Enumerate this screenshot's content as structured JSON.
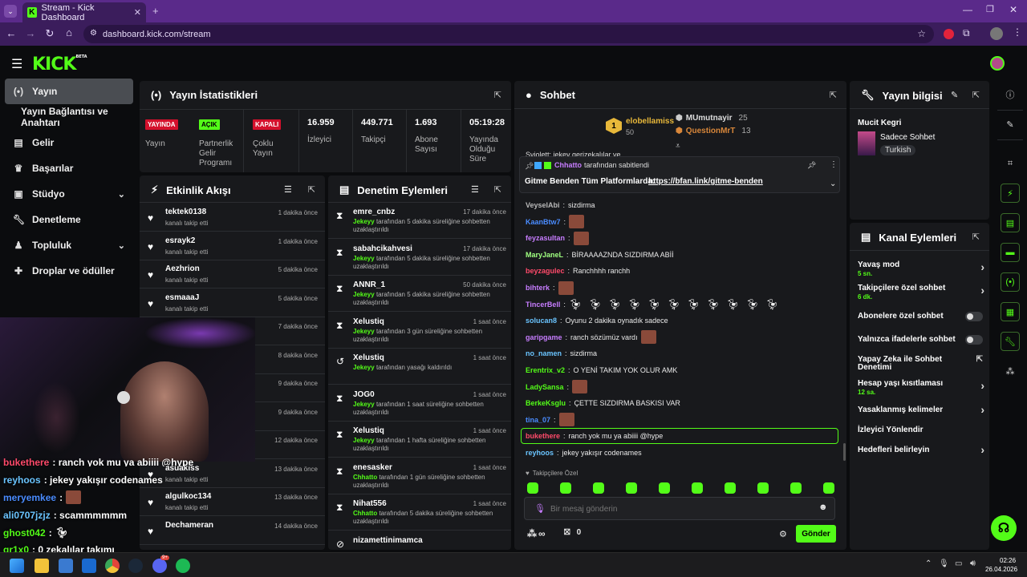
{
  "browser": {
    "tab_title": "Stream - Kick Dashboard",
    "url": "dashboard.kick.com/stream"
  },
  "app": {
    "logo": "KICK",
    "logo_sup": "BETA"
  },
  "sidebar": {
    "items": [
      {
        "label": "Yayın",
        "icon": "broadcast-icon"
      },
      {
        "label": "Yayın Bağlantısı ve Anahtarı",
        "icon": ""
      },
      {
        "label": "Gelir",
        "icon": "chart-icon"
      },
      {
        "label": "Başarılar",
        "icon": "trophy-icon"
      },
      {
        "label": "Stüdyo",
        "icon": "studio-icon"
      },
      {
        "label": "Denetleme",
        "icon": "wrench-icon"
      },
      {
        "label": "Topluluk",
        "icon": "community-icon"
      },
      {
        "label": "Droplar ve ödüller",
        "icon": "gift-icon"
      }
    ]
  },
  "stats": {
    "title": "Yayın İstatistikleri",
    "items": [
      {
        "badge": "YAYINDA",
        "label": "Yayın"
      },
      {
        "badge": "AÇIK",
        "label": "Partnerlik Gelir Programı"
      },
      {
        "badge": "KAPALI",
        "label": "Çoklu Yayın"
      },
      {
        "value": "16.959",
        "label": "İzleyici"
      },
      {
        "value": "449.771",
        "label": "Takipçi"
      },
      {
        "value": "1.693",
        "label": "Abone Sayısı"
      },
      {
        "value": "05:19:28",
        "label": "Yayında Olduğu Süre"
      }
    ]
  },
  "activity": {
    "title": "Etkinlik Akışı",
    "rows": [
      {
        "name": "tektek0138",
        "sub": "kanalı takip etti",
        "time": "1 dakika önce"
      },
      {
        "name": "esrayk2",
        "sub": "kanalı takip etti",
        "time": "1 dakika önce"
      },
      {
        "name": "Aezhrion",
        "sub": "kanalı takip etti",
        "time": "5 dakika önce"
      },
      {
        "name": "esmaaaJ",
        "sub": "kanalı takip etti",
        "time": "5 dakika önce"
      },
      {
        "name": "",
        "sub": "",
        "time": "7 dakika önce"
      },
      {
        "name": "",
        "sub": "",
        "time": "8 dakika önce"
      },
      {
        "name": "",
        "sub": "",
        "time": "9 dakika önce"
      },
      {
        "name": "",
        "sub": "",
        "time": "9 dakika önce"
      },
      {
        "name": "",
        "sub": "kanalı takip etti",
        "time": "12 dakika önce"
      },
      {
        "name": "asuakiss",
        "sub": "kanalı takip etti",
        "time": "13 dakika önce"
      },
      {
        "name": "algulkoc134",
        "sub": "kanalı takip etti",
        "time": "13 dakika önce"
      },
      {
        "name": "Dechameran",
        "sub": "",
        "time": "14 dakika önce"
      }
    ]
  },
  "moderation": {
    "title": "Denetim Eylemleri",
    "rows": [
      {
        "name": "emre_cnbz",
        "actor": "Jekeyy",
        "desc": "tarafından 5 dakika süreliğine sohbetten uzaklaştırıldı",
        "time": "17 dakika önce",
        "icon": "hourglass-icon"
      },
      {
        "name": "sabahcikahvesi",
        "actor": "Jekeyy",
        "desc": "tarafından 5 dakika süreliğine sohbetten uzaklaştırıldı",
        "time": "17 dakika önce",
        "icon": "hourglass-icon"
      },
      {
        "name": "ANNR_1",
        "actor": "Jekeyy",
        "desc": "tarafından 5 dakika süreliğine sohbetten uzaklaştırıldı",
        "time": "50 dakika önce",
        "icon": "hourglass-icon"
      },
      {
        "name": "Xelustiq",
        "actor": "Jekeyy",
        "desc": "tarafından 3 gün süreliğine sohbetten uzaklaştırıldı",
        "time": "1 saat önce",
        "icon": "hourglass-icon"
      },
      {
        "name": "Xelustiq",
        "actor": "Jekeyy",
        "desc": "tarafından yasağı kaldırıldı",
        "time": "1 saat önce",
        "icon": "undo-icon"
      },
      {
        "name": "JOG0",
        "actor": "Jekeyy",
        "desc": "tarafından 1 saat süreliğine sohbetten uzaklaştırıldı",
        "time": "1 saat önce",
        "icon": "hourglass-icon"
      },
      {
        "name": "Xelustiq",
        "actor": "Jekeyy",
        "desc": "tarafından 1 hafta süreliğine sohbetten uzaklaştırıldı",
        "time": "1 saat önce",
        "icon": "hourglass-icon"
      },
      {
        "name": "enesasker",
        "actor": "Chhatto",
        "desc": "tarafından 1 gün süreliğine sohbetten uzaklaştırıldı",
        "time": "1 saat önce",
        "icon": "hourglass-icon"
      },
      {
        "name": "Nihat556",
        "actor": "Chhatto",
        "desc": "tarafından 5 dakika süreliğine sohbetten uzaklaştırıldı",
        "time": "1 saat önce",
        "icon": "hourglass-icon"
      },
      {
        "name": "nizamettinimamca",
        "actor": "",
        "desc": "",
        "time": "",
        "icon": "ban-icon"
      }
    ]
  },
  "chat": {
    "title": "Sohbet",
    "top_gifters": [
      {
        "name": "elobellamiss",
        "value": "50"
      },
      {
        "name": "MUmutnayir",
        "value": "25"
      },
      {
        "name": "QuestionMrT",
        "value": "13"
      }
    ],
    "partial_line": "Sviolett: jekey gerizekalılar ve",
    "pinned": {
      "by": "Chhatto",
      "label": "tarafından sabitlendi",
      "text": "Gitme Benden Tüm Platformlarda:",
      "link": "https://bfan.link/gitme-benden"
    },
    "messages": [
      {
        "user": "VeyselAbi",
        "text": "sizdirma",
        "color": "#b8b8b8"
      },
      {
        "user": "KaanBtw7",
        "text": "",
        "color": "#4a8cff",
        "emote": true
      },
      {
        "user": "feyzasultan",
        "text": "",
        "color": "#c77dff",
        "emote": true
      },
      {
        "user": "MaryJaneL",
        "text": "BİRAAAAZNDA SIZDIRMA ABİİ",
        "color": "#a0ff80"
      },
      {
        "user": "beyzagulec",
        "text": "Ranchhhh ranchh",
        "color": "#ff4a6a"
      },
      {
        "user": "bihterk",
        "text": "",
        "color": "#c77dff",
        "emote": true
      },
      {
        "user": "TincerBell",
        "text": "",
        "color": "#c77dff",
        "ducks": true
      },
      {
        "user": "solucan8",
        "text": "Oyunu 2 dakika oynadık sadece",
        "color": "#6ac4ff"
      },
      {
        "user": "garipgame",
        "text": "ranch sözümüz vardı",
        "color": "#c77dff",
        "emote": true
      },
      {
        "user": "no_namen",
        "text": "sizdirma",
        "color": "#6ac4ff"
      },
      {
        "user": "Erentrix_v2",
        "text": "O YENİ TAKIM YOK OLUR AMK",
        "color": "#53fc18"
      },
      {
        "user": "LadySansa",
        "text": "",
        "color": "#53fc18",
        "emote": true
      },
      {
        "user": "BerkeKsglu",
        "text": "ÇETTE SIZDIRMA BASKISI VAR",
        "color": "#53fc18"
      },
      {
        "user": "tina_07",
        "text": "",
        "color": "#4a8cff",
        "emote": true
      },
      {
        "user": "bukethere",
        "text": "ranch yok mu ya abiiii @hype",
        "color": "#ff4a6a"
      },
      {
        "user": "reyhoos",
        "text": "jekey yakışır codenames",
        "color": "#6ac4ff"
      }
    ],
    "followers_only": "Takipçilere Özel",
    "input_placeholder": "Bir mesaj gönderin",
    "infinity": "∞",
    "gift_count": "0",
    "send_label": "Gönder"
  },
  "stream_info": {
    "title": "Yayın bilgisi",
    "stream_title": "Mucit Kegri",
    "category": "Sadece Sohbet",
    "language": "Turkish"
  },
  "channel_actions": {
    "title": "Kanal Eylemleri",
    "rows": [
      {
        "label": "Yavaş mod",
        "value": "5 sn.",
        "control": "arrow"
      },
      {
        "label": "Takipçilere özel sohbet",
        "value": "6 dk.",
        "control": "arrow"
      },
      {
        "label": "Abonelere özel sohbet",
        "value": "",
        "control": "toggle"
      },
      {
        "label": "Yalnızca ifadelerle sohbet",
        "value": "",
        "control": "toggle"
      },
      {
        "label": "Yapay Zeka ile Sohbet Denetimi",
        "value": "",
        "control": "external"
      },
      {
        "label": "Hesap yaşı kısıtlaması",
        "value": "12 sa.",
        "control": "arrow"
      },
      {
        "label": "Yasaklanmış kelimeler",
        "value": "",
        "control": "arrow"
      },
      {
        "label": "İzleyici Yönlendir",
        "value": "",
        "control": "none"
      },
      {
        "label": "Hedefleri belirleyin",
        "value": "",
        "control": "arrow"
      }
    ]
  },
  "overlay_chat": [
    {
      "user": "bukethere",
      "text": ": ranch yok mu ya abiiii @hype",
      "color": "#ff4a6a"
    },
    {
      "user": "reyhoos",
      "text": ": jekey yakışır codenames",
      "color": "#6ac4ff"
    },
    {
      "user": "meryemkee",
      "text": ":",
      "color": "#4a8cff"
    },
    {
      "user": "ali0707jzjz",
      "text": ": scammmmmm",
      "color": "#6ac4ff"
    },
    {
      "user": "ghost042",
      "text": ":",
      "color": "#53fc18"
    },
    {
      "user": "qr1x0",
      "text": ": 0 zekalılar takımı",
      "color": "#53fc18"
    }
  ],
  "taskbar": {
    "time": "02:26",
    "date": "26.04.2026",
    "discord_badge": "9+"
  }
}
